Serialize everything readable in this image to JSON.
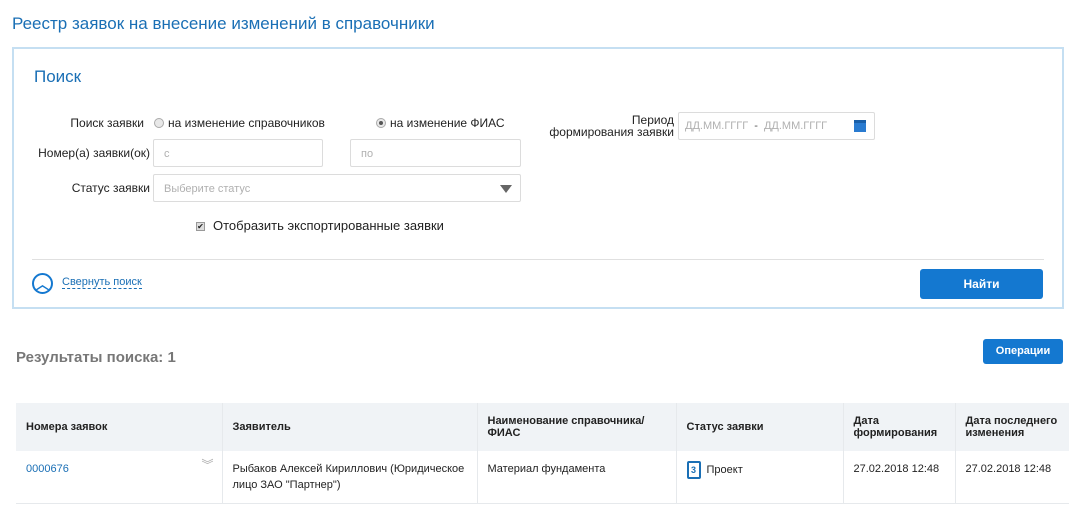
{
  "page_title": "Реестр заявок на внесение изменений в справочники",
  "search": {
    "title": "Поиск",
    "search_type_label": "Поиск заявки",
    "radio_options": [
      {
        "label": "на изменение справочников",
        "selected": false
      },
      {
        "label": "на изменение ФИАС",
        "selected": true
      }
    ],
    "number_label": "Номер(а) заявки(ок)",
    "number_from_placeholder": "с",
    "number_to_placeholder": "по",
    "status_label": "Статус заявки",
    "status_placeholder": "Выберите статус",
    "show_exported_label": "Отобразить экспортированные заявки",
    "show_exported_checked": true,
    "period_label_1": "Период",
    "period_label_2": "формирования заявки",
    "period_from_placeholder": "ДД.ММ.ГГГГ",
    "period_sep": "-",
    "period_to_placeholder": "ДД.ММ.ГГГГ",
    "collapse_label": "Свернуть поиск",
    "find_button": "Найти"
  },
  "results": {
    "title": "Результаты поиска: 1",
    "operations_button": "Операции",
    "columns": [
      "Номера заявок",
      "Заявитель",
      "Наименование справочника/ ФИАС",
      "Статус заявки",
      "Дата формирования",
      "Дата последнего изменения"
    ],
    "rows": [
      {
        "number": "0000676",
        "applicant": "Рыбаков Алексей Кириллович (Юридическое лицо ЗАО \"Партнер\")",
        "name": "Материал фундамента",
        "status": "Проект",
        "created": "27.02.2018 12:48",
        "modified": "27.02.2018 12:48"
      }
    ]
  },
  "colors": {
    "accent": "#1478d0",
    "title": "#1a6fb5",
    "panel_border": "#c5dff2"
  }
}
